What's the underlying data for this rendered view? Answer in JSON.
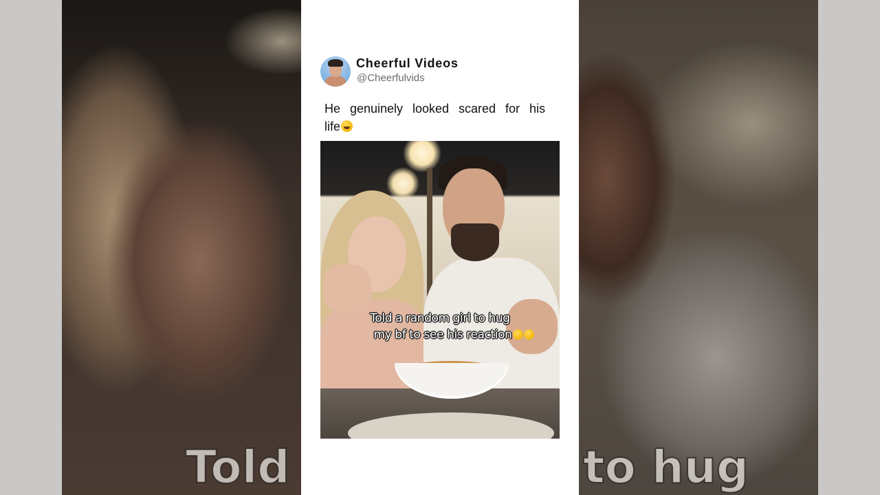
{
  "post": {
    "display_name": "Cheerful Videos",
    "handle": "@Cheerfulvids",
    "text": "He genuinely looked scared for his life",
    "text_emoji": "rolling-on-the-floor-laughing-emoji"
  },
  "video": {
    "caption_line1": "Told a random girl to hug",
    "caption_line2": "my bf to see his reaction",
    "caption_emojis": [
      "loudly-crying-emoji",
      "tears-of-joy-emoji"
    ]
  },
  "background": {
    "caption_left": "Told a",
    "caption_right": "to hug"
  }
}
